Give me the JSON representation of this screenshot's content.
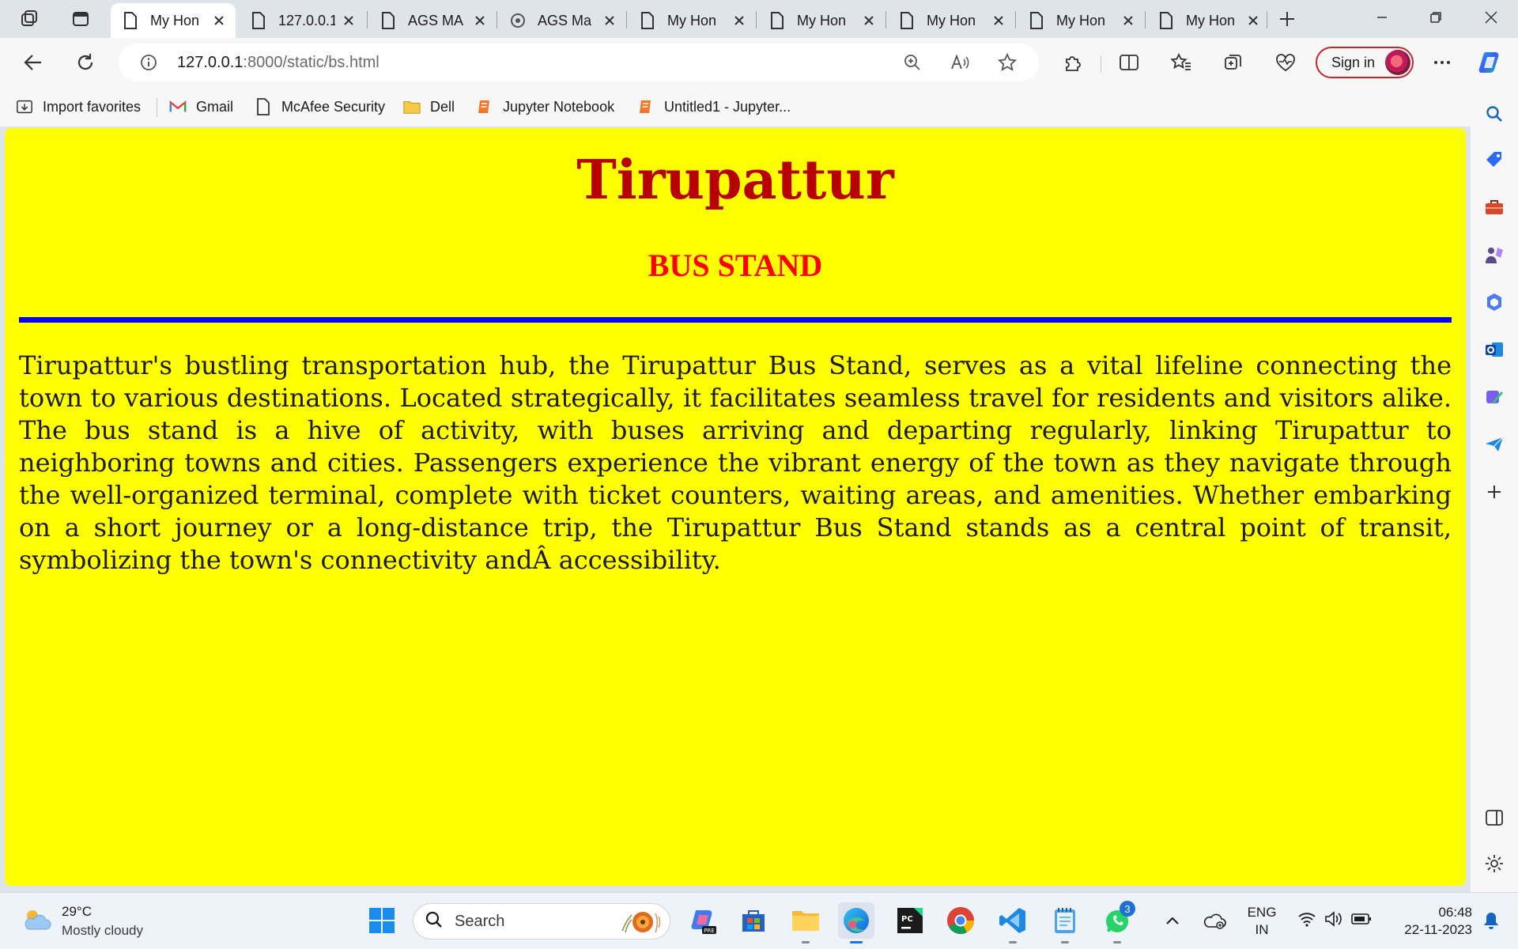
{
  "browser": {
    "tabs": [
      {
        "title": "My Hon",
        "active": true
      },
      {
        "title": "127.0.0.1",
        "active": false
      },
      {
        "title": "AGS MA",
        "active": false
      },
      {
        "title": "AGS Ma",
        "active": false
      },
      {
        "title": "My Hon",
        "active": false
      },
      {
        "title": "My Hon",
        "active": false
      },
      {
        "title": "My Hon",
        "active": false
      },
      {
        "title": "My Hon",
        "active": false
      },
      {
        "title": "My Hon",
        "active": false
      }
    ],
    "address": {
      "host": "127.0.0.1",
      "path": ":8000/static/bs.html"
    },
    "sign_in_label": "Sign in",
    "favorites": [
      {
        "label": "Import favorites",
        "icon": "import-icon"
      },
      {
        "label": "Gmail",
        "icon": "gmail-icon"
      },
      {
        "label": "McAfee Security",
        "icon": "page-icon"
      },
      {
        "label": "Dell",
        "icon": "folder-icon"
      },
      {
        "label": "Jupyter Notebook",
        "icon": "jupyter-icon"
      },
      {
        "label": "Untitled1 - Jupyter...",
        "icon": "jupyter-icon"
      }
    ]
  },
  "page": {
    "title": "Tirupattur",
    "subtitle": "BUS STAND",
    "paragraph": "Tirupattur's bustling transportation hub, the Tirupattur Bus Stand, serves as a vital lifeline connecting the town to various destinations. Located strategically, it facilitates seamless travel for residents and visitors alike. The bus stand is a hive of activity, with buses arriving and departing regularly, linking Tirupattur to neighboring towns and cities. Passengers experience the vibrant energy of the town as they navigate through the well-organized terminal, complete with ticket counters, waiting areas, and amenities. Whether embarking on a short journey or a long-distance trip, the Tirupattur Bus Stand stands as a central point of transit, symbolizing the town's connectivity andÂ accessibility.",
    "colors": {
      "background": "#ffff00",
      "title": "#b80000",
      "subtitle": "#ff0000",
      "rule": "#0000ff"
    }
  },
  "taskbar": {
    "weather": {
      "temp": "29°C",
      "condition": "Mostly cloudy"
    },
    "search_label": "Search",
    "whatsapp_badge": "3",
    "language": {
      "line1": "ENG",
      "line2": "IN"
    },
    "clock": {
      "time": "06:48",
      "date": "22-11-2023"
    }
  }
}
